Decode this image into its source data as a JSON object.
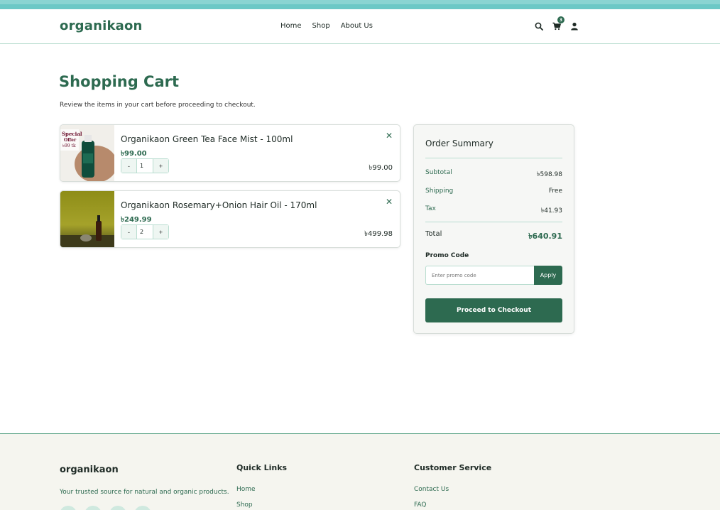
{
  "header": {
    "brand": "organikaon",
    "nav": [
      "Home",
      "Shop",
      "About Us"
    ],
    "cart_count": "3",
    "icons": [
      "search-icon",
      "cart-icon",
      "user-icon"
    ]
  },
  "page": {
    "title": "Shopping Cart",
    "subtitle": "Review the items in your cart before proceeding to checkout."
  },
  "cart": {
    "items": [
      {
        "name": "Organikaon Green Tea Face Mist - 100ml",
        "price": "৳99.00",
        "qty": "1",
        "line_total": "৳99.00",
        "image_text": "Special Offer ৳99 tk"
      },
      {
        "name": "Organikaon Rosemary+Onion Hair Oil - 170ml",
        "price": "৳249.99",
        "qty": "2",
        "line_total": "৳499.98"
      }
    ],
    "remove_glyph": "✕",
    "minus": "-",
    "plus": "+"
  },
  "summary": {
    "title": "Order Summary",
    "subtotal_label": "Subtotal",
    "subtotal": "৳598.98",
    "shipping_label": "Shipping",
    "shipping": "Free",
    "tax_label": "Tax",
    "tax": "৳41.93",
    "total_label": "Total",
    "total": "৳640.91",
    "promo_label": "Promo Code",
    "promo_placeholder": "Enter promo code",
    "apply_label": "Apply",
    "checkout_label": "Proceed to Checkout"
  },
  "footer": {
    "brand": "organikaon",
    "tagline": "Your trusted source for natural and organic products.",
    "quick_links_title": "Quick Links",
    "quick_links": [
      "Home",
      "Shop"
    ],
    "service_title": "Customer Service",
    "service_links": [
      "Contact Us",
      "FAQ"
    ]
  },
  "colors": {
    "accent": "#2d6a50",
    "topbar": "#7ccfcc",
    "footer_bg": "#f5f5ef"
  }
}
